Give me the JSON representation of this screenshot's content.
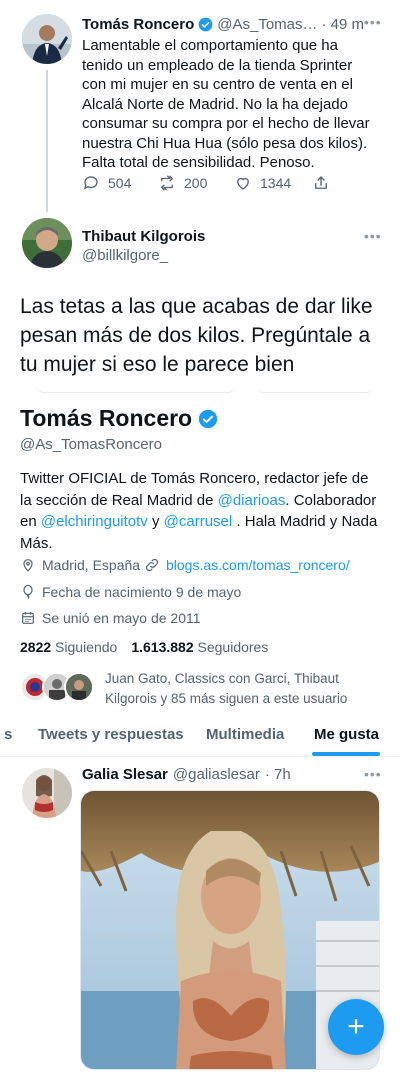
{
  "tweet1": {
    "author_name": "Tomás Roncero",
    "handle": "@As_Tomas…",
    "time": "· 49 m",
    "text": "Lamentable el comportamiento que ha tenido un empleado de la tienda Sprinter con mi mujer en su centro de venta en el Alcalá Norte de Madrid. No la ha dejado consumar su compra por el hecho de llevar nuestra Chi Hua Hua (sólo pesa dos kilos). Falta total de sensibilidad. Penoso.",
    "replies": "504",
    "retweets": "200",
    "likes": "1344"
  },
  "reply": {
    "author_name": "Thibaut Kilgorois",
    "handle": "@billkilgore_",
    "text": "Las tetas a las que acabas de dar like pesan más de dos kilos. Pregúntale a tu mujer si eso le parece bien"
  },
  "profile": {
    "name": "Tomás Roncero",
    "handle": "@As_TomasRoncero",
    "bio_part1": "Twitter OFICIAL de Tomás Roncero, redactor jefe de la sección de Real Madrid de ",
    "bio_link1": "@diarioas",
    "bio_part2": ". Colaborador en ",
    "bio_link2": "@elchiringuitotv",
    "bio_part3": " y ",
    "bio_link3": "@carrusel",
    "bio_part4": " . Hala Madrid y Nada Más.",
    "location": "Madrid, España",
    "website": "blogs.as.com/tomas_roncero/",
    "birthday": "Fecha de nacimiento 9 de mayo",
    "joined": "Se unió en mayo de 2011",
    "following_count": "2822",
    "following_label": "Siguiendo",
    "followers_count": "1.613.882",
    "followers_label": "Seguidores",
    "followed_by": "Juan Gato, Classics con Garci, Thibaut Kilgorois y 85 más siguen a este usuario"
  },
  "tabs": {
    "partial": "s",
    "tweets_replies": "Tweets y respuestas",
    "media": "Multimedia",
    "likes": "Me gusta"
  },
  "liked_tweet": {
    "author_name": "Galia Slesar",
    "handle": "@galiaslesar",
    "time": "· 7h"
  },
  "fab": {
    "label": "+"
  },
  "colors": {
    "accent": "#1d9bf0",
    "text": "#0f1419",
    "secondary": "#536471"
  }
}
